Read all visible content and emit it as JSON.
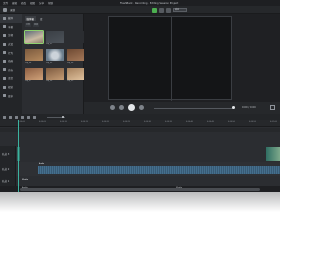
{
  "menubar": {
    "items": [
      "文件",
      "编辑",
      "修改",
      "视图",
      "分享",
      "帮助"
    ],
    "window_title": "FlashBack · Recording · Editing Session Project"
  },
  "toolbar": {
    "record_label": "录制",
    "zoom_value": "适应"
  },
  "sidebar": {
    "items": [
      {
        "label": "媒体",
        "icon": "folder-icon"
      },
      {
        "label": "字幕",
        "icon": "text-icon"
      },
      {
        "label": "注释",
        "icon": "annotation-icon"
      },
      {
        "label": "过渡",
        "icon": "transition-icon"
      },
      {
        "label": "行为",
        "icon": "behavior-icon"
      },
      {
        "label": "动画",
        "icon": "animation-icon"
      },
      {
        "label": "光标",
        "icon": "cursor-icon"
      },
      {
        "label": "语音",
        "icon": "voice-icon"
      },
      {
        "label": "视觉",
        "icon": "visual-effects-icon"
      },
      {
        "label": "更多",
        "icon": "more-icon"
      }
    ]
  },
  "media": {
    "tabs": [
      "媒体箱",
      "库"
    ],
    "sub_filters": [
      "全部",
      "视频"
    ],
    "thumbnails": [
      {
        "caption": "clip_01"
      },
      {
        "caption": "clip_02"
      },
      {
        "caption": ""
      },
      {
        "caption": "clip_04"
      },
      {
        "caption": "clip_05"
      },
      {
        "caption": "clip_06"
      },
      {
        "caption": "clip_07"
      },
      {
        "caption": "clip_08"
      },
      {
        "caption": "clip_09"
      }
    ]
  },
  "player": {
    "timecode": "0:00 / 0:00",
    "progress": 0.98
  },
  "timeline": {
    "ruler_ticks": [
      "0:00:00",
      "0:00:05",
      "0:00:10",
      "0:00:15",
      "0:00:20",
      "0:00:25",
      "0:00:30",
      "0:00:35",
      "0:00:40",
      "0:00:45",
      "0:00:50",
      "0:00:55",
      "0:01:00"
    ],
    "tracks": [
      {
        "name": "轨道 3",
        "clip_label": ""
      },
      {
        "name": "轨道 2",
        "clip_label": "Audio"
      },
      {
        "name": "轨道 1",
        "clip_label": "Media"
      }
    ],
    "bottom_labels": [
      "Audio",
      "Media"
    ]
  },
  "colors": {
    "accent": "#4caf50",
    "playhead": "#3bb3a0",
    "video_clip": "#2f6e63",
    "audio_wave": "#4a7fa3"
  }
}
